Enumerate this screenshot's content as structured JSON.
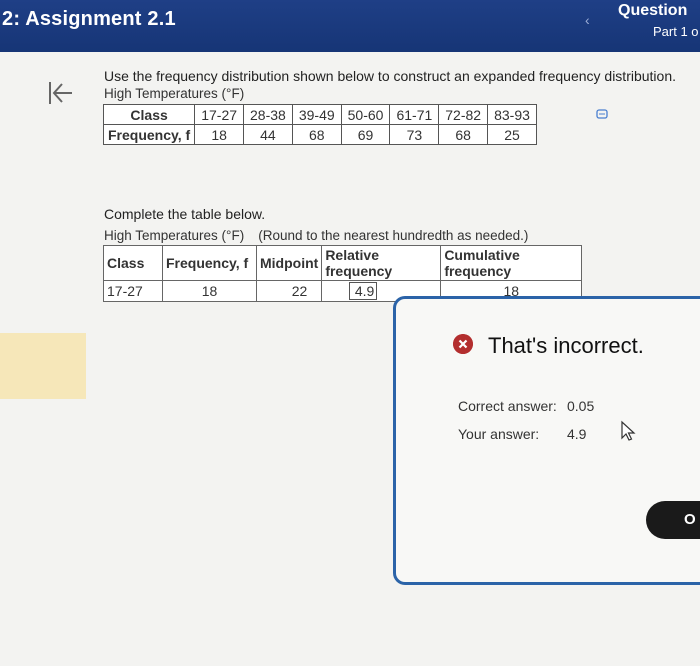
{
  "header": {
    "title": "2: Assignment 2.1",
    "question_label": "Question",
    "part_label": "Part 1 o"
  },
  "intro": {
    "instruction": "Use the frequency distribution shown below to construct an expanded frequency distribution.",
    "caption": "High Temperatures (°F)"
  },
  "given_table": {
    "row_labels": [
      "Class",
      "Frequency, f"
    ],
    "classes": [
      "17-27",
      "28-38",
      "39-49",
      "50-60",
      "61-71",
      "72-82",
      "83-93"
    ],
    "frequencies": [
      "18",
      "44",
      "68",
      "69",
      "73",
      "68",
      "25"
    ]
  },
  "complete": {
    "prompt": "Complete the table below.",
    "caption": "High Temperatures (°F)",
    "rounding_note": "(Round to the nearest hundredth as needed.)"
  },
  "answer_table": {
    "headers": {
      "class": "Class",
      "frequency": "Frequency, f",
      "midpoint": "Midpoint",
      "relative": "Relative frequency",
      "cumulative": "Cumulative frequency"
    },
    "row": {
      "class": "17-27",
      "frequency": "18",
      "midpoint": "22",
      "relative_input": "4.9",
      "cumulative": "18"
    }
  },
  "feedback": {
    "title": "That's incorrect.",
    "correct_label": "Correct answer:",
    "correct_value": "0.05",
    "your_label": "Your answer:",
    "your_value": "4.9",
    "ok_label": "OK",
    "ok_visible_text": "O"
  },
  "colors": {
    "header_bg": "#1f3f86",
    "feedback_border": "#2b63a8",
    "error_red": "#b32e2e",
    "highlight_bar": "#f6e7b9"
  },
  "icons": [
    "back-to-start-icon",
    "chevron-left-icon",
    "copy-icon",
    "error-x-icon",
    "mouse-cursor-icon"
  ]
}
